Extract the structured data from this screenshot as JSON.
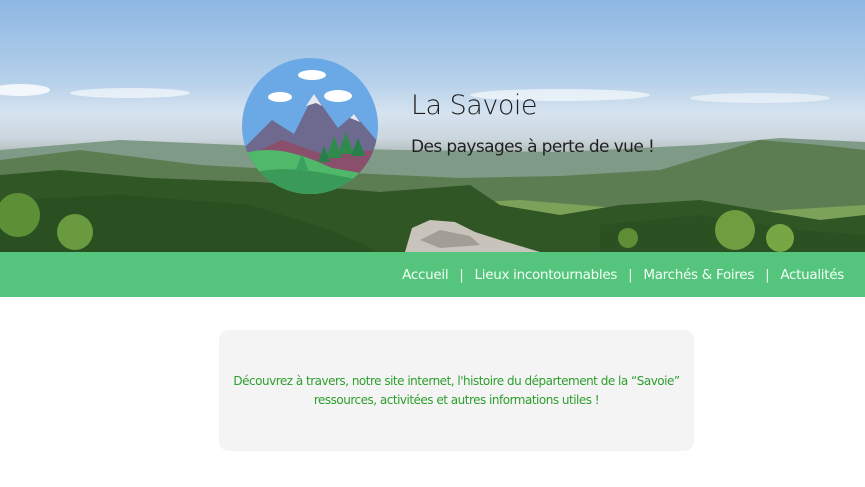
{
  "header": {
    "title": "La Savoie",
    "tagline": "Des paysages à perte de vue !"
  },
  "nav": {
    "items": [
      {
        "label": "Accueil"
      },
      {
        "label": "Lieux incontournables"
      },
      {
        "label": "Marchés & Foires"
      },
      {
        "label": "Actualités"
      }
    ],
    "separator": "|"
  },
  "intro": {
    "line1": "Découvrez à travers, notre site internet, l'histoire du département de la “Savoie”",
    "line2": "ressources, activitées et autres informations utiles !"
  },
  "colors": {
    "nav_bg": "#55c47c",
    "nav_text": "#f2fff6",
    "intro_text": "#2e9e2e",
    "card_bg": "#f4f4f4"
  },
  "icons": {
    "logo": "mountain-landscape-logo"
  }
}
